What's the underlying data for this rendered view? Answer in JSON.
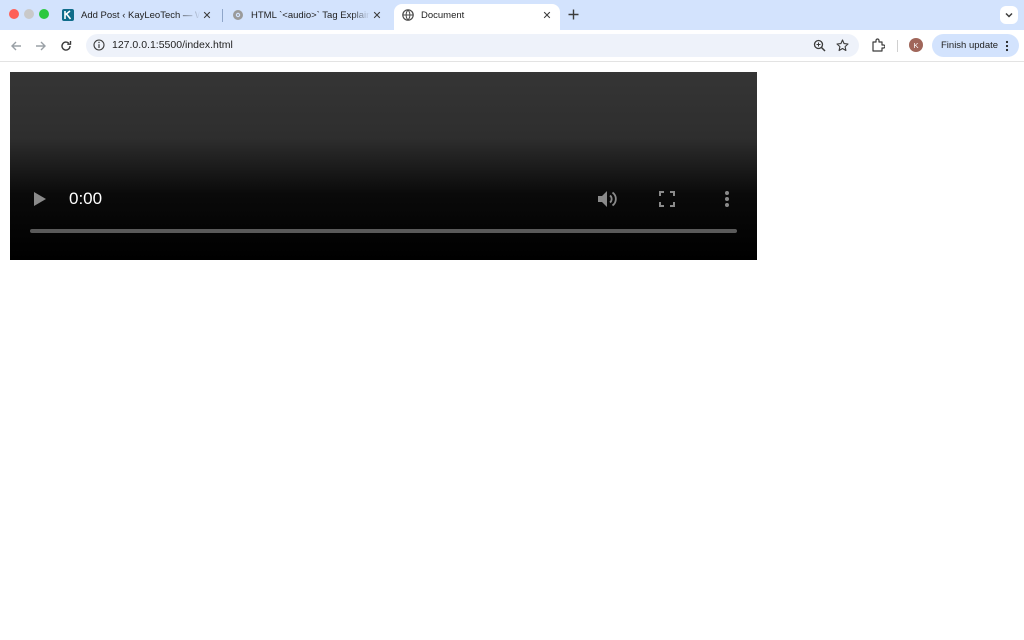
{
  "browser": {
    "tabs": [
      {
        "title": "Add Post ‹ KayLeoTech — WordPress",
        "favicon": "kayleotech-icon",
        "active": false
      },
      {
        "title": "HTML `<audio>` Tag Explained",
        "favicon": "globe-gray-icon",
        "active": false
      },
      {
        "title": "Document",
        "favicon": "globe-icon",
        "active": true
      }
    ],
    "url": "127.0.0.1:5500/index.html",
    "avatar_initial": "K",
    "finish_update_label": "Finish update"
  },
  "video_player": {
    "time": "0:00",
    "progress": 0,
    "controls": [
      "play-icon",
      "volume-icon",
      "fullscreen-icon",
      "more-options-icon"
    ]
  },
  "colors": {
    "tabstrip": "#d3e3fd",
    "omnibox": "#eef2fa",
    "avatar": "#a0665a",
    "video_top": "#353535",
    "video_bottom": "#000000"
  }
}
